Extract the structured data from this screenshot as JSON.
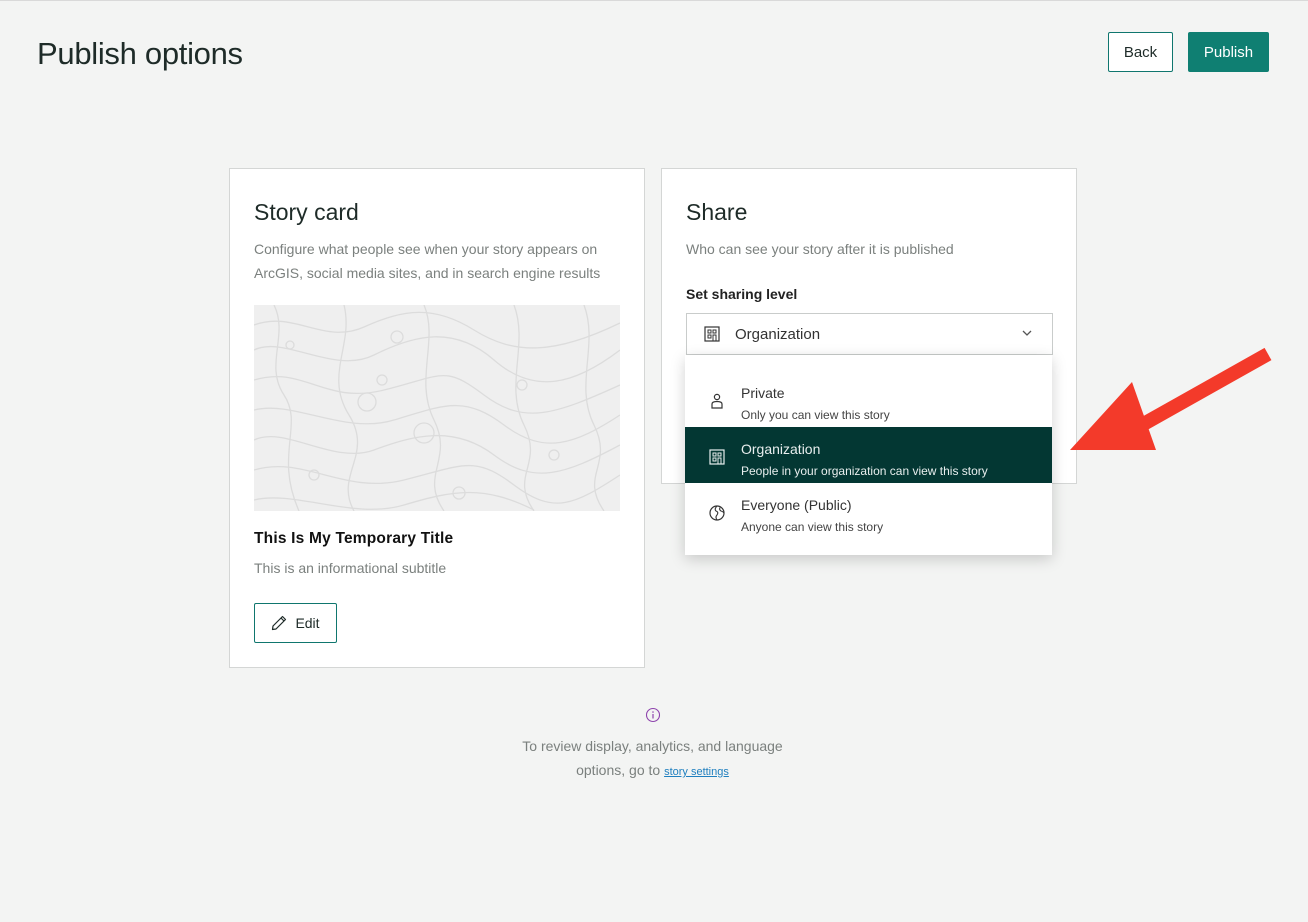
{
  "header": {
    "title": "Publish options",
    "back_label": "Back",
    "publish_label": "Publish"
  },
  "story_card": {
    "heading": "Story card",
    "description": "Configure what people see when your story appears on ArcGIS, social media sites, and in search engine results",
    "title": "This Is My Temporary Title",
    "subtitle": "This is an informational subtitle",
    "edit_label": "Edit"
  },
  "share": {
    "heading": "Share",
    "description": "Who can see your story after it is published",
    "sharing_label": "Set sharing level",
    "selected_value": "Organization",
    "options": [
      {
        "label": "Private",
        "sub": "Only you can view this story",
        "icon": "person-icon"
      },
      {
        "label": "Organization",
        "sub": "People in your organization can view this story",
        "icon": "organization-icon",
        "selected": true
      },
      {
        "label": "Everyone (Public)",
        "sub": "Anyone can view this story",
        "icon": "globe-icon"
      }
    ]
  },
  "footer_note": {
    "text": "To review display, analytics, and language options, go to",
    "link": "story settings"
  },
  "colors": {
    "accent": "#0f7f72",
    "selected_item": "#033733",
    "annotation_arrow": "#f33a2a"
  }
}
